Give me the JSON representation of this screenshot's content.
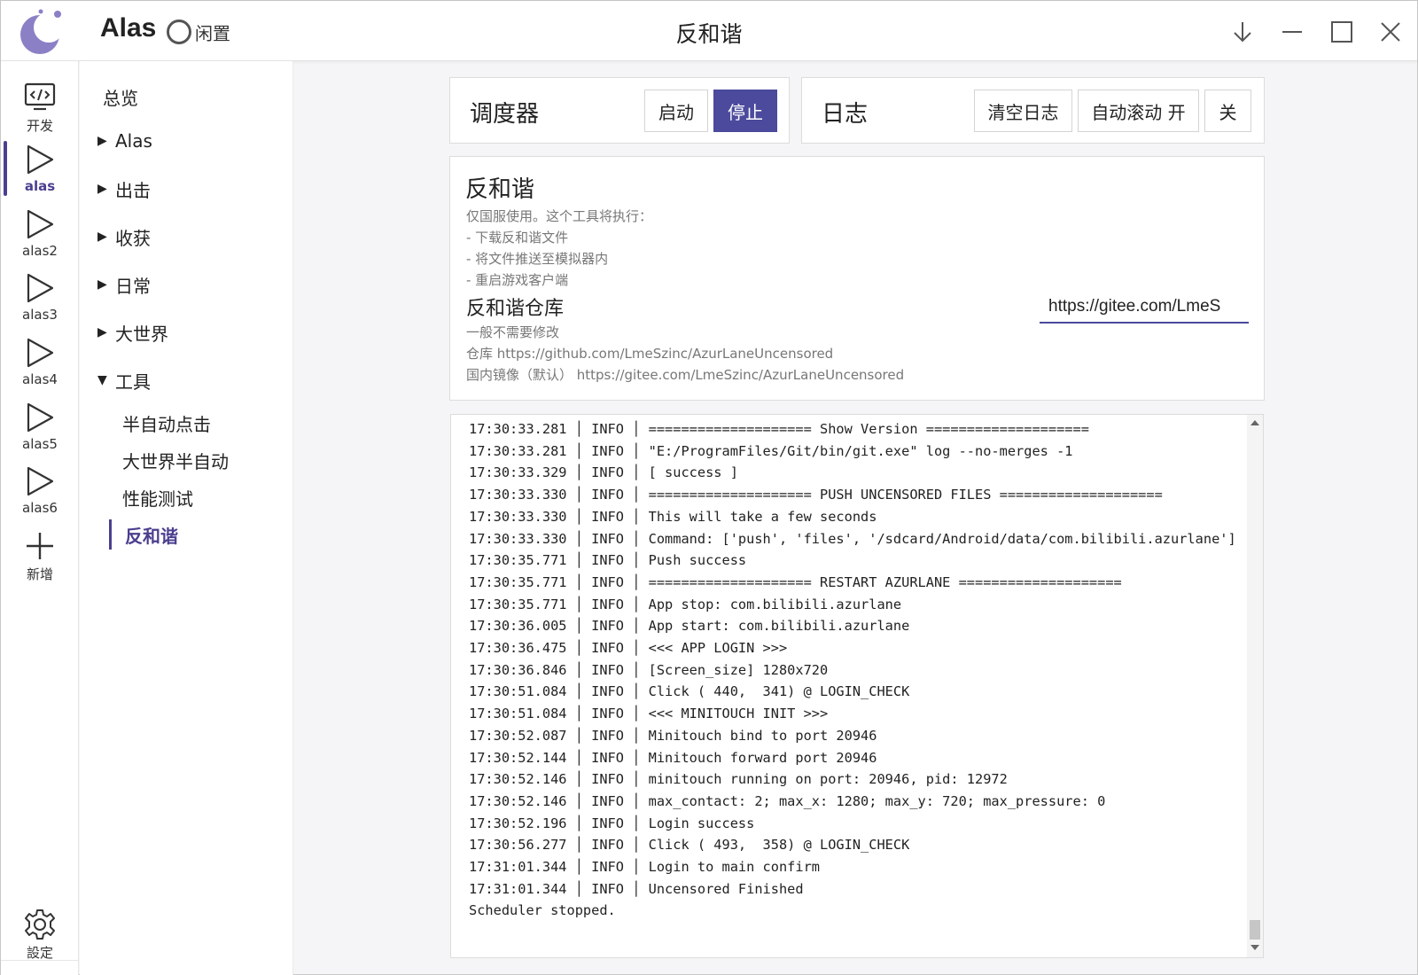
{
  "titlebar": {
    "app_name": "Alas",
    "status": "闲置",
    "page_title": "反和谐"
  },
  "rail": {
    "items": [
      {
        "label": "开发",
        "icon": "dev-icon"
      },
      {
        "label": "alas",
        "icon": "play-icon",
        "active": true
      },
      {
        "label": "alas2",
        "icon": "play-icon"
      },
      {
        "label": "alas3",
        "icon": "play-icon"
      },
      {
        "label": "alas4",
        "icon": "play-icon"
      },
      {
        "label": "alas5",
        "icon": "play-icon"
      },
      {
        "label": "alas6",
        "icon": "play-icon"
      },
      {
        "label": "新增",
        "icon": "plus-icon"
      }
    ],
    "settings_label": "設定"
  },
  "menu": {
    "overview": "总览",
    "groups": [
      "Alas",
      "出击",
      "收获",
      "日常",
      "大世界"
    ],
    "tools_group": "工具",
    "tools_items": [
      "半自动点击",
      "大世界半自动",
      "性能测试",
      "反和谐"
    ]
  },
  "scheduler": {
    "title": "调度器",
    "start": "启动",
    "stop": "停止"
  },
  "logbar": {
    "title": "日志",
    "clear": "清空日志",
    "autoscroll": "自动滚动 开",
    "close": "关"
  },
  "task": {
    "title": "反和谐",
    "desc": [
      "仅国服使用。这个工具将执行：",
      "- 下载反和谐文件",
      "- 将文件推送至模拟器内",
      "- 重启游戏客户端"
    ],
    "repo_title": "反和谐仓库",
    "repo_desc": [
      "一般不需要修改",
      "仓库 https://github.com/LmeSzinc/AzurLaneUncensored",
      "国内镜像（默认） https://gitee.com/LmeSzinc/AzurLaneUncensored"
    ],
    "repo_value": "https://gitee.com/LmeS"
  },
  "log": [
    "17:30:33.281 │ INFO │ ==================== Show Version ====================",
    "17:30:33.281 │ INFO │ \"E:/ProgramFiles/Git/bin/git.exe\" log --no-merges -1",
    "17:30:33.329 │ INFO │ [ success ]",
    "17:30:33.330 │ INFO │ ==================== PUSH UNCENSORED FILES ====================",
    "17:30:33.330 │ INFO │ This will take a few seconds",
    "17:30:33.330 │ INFO │ Command: ['push', 'files', '/sdcard/Android/data/com.bilibili.azurlane']",
    "17:30:35.771 │ INFO │ Push success",
    "17:30:35.771 │ INFO │ ==================== RESTART AZURLANE ====================",
    "17:30:35.771 │ INFO │ App stop: com.bilibili.azurlane",
    "17:30:36.005 │ INFO │ App start: com.bilibili.azurlane",
    "17:30:36.475 │ INFO │ <<< APP LOGIN >>>",
    "17:30:36.846 │ INFO │ [Screen_size] 1280x720",
    "17:30:51.084 │ INFO │ Click ( 440,  341) @ LOGIN_CHECK",
    "17:30:51.084 │ INFO │ <<< MINITOUCH INIT >>>",
    "17:30:52.087 │ INFO │ Minitouch bind to port 20946",
    "17:30:52.144 │ INFO │ Minitouch forward port 20946",
    "17:30:52.146 │ INFO │ minitouch running on port: 20946, pid: 12972",
    "17:30:52.146 │ INFO │ max_contact: 2; max_x: 1280; max_y: 720; max_pressure: 0",
    "17:30:52.196 │ INFO │ Login success",
    "17:30:56.277 │ INFO │ Click ( 493,  358) @ LOGIN_CHECK",
    "17:31:01.344 │ INFO │ Login to main confirm",
    "17:31:01.344 │ INFO │ Uncensored Finished",
    "Scheduler stopped."
  ],
  "colors": {
    "accent": "#4b4a9c",
    "logo": "#8b80c6"
  }
}
